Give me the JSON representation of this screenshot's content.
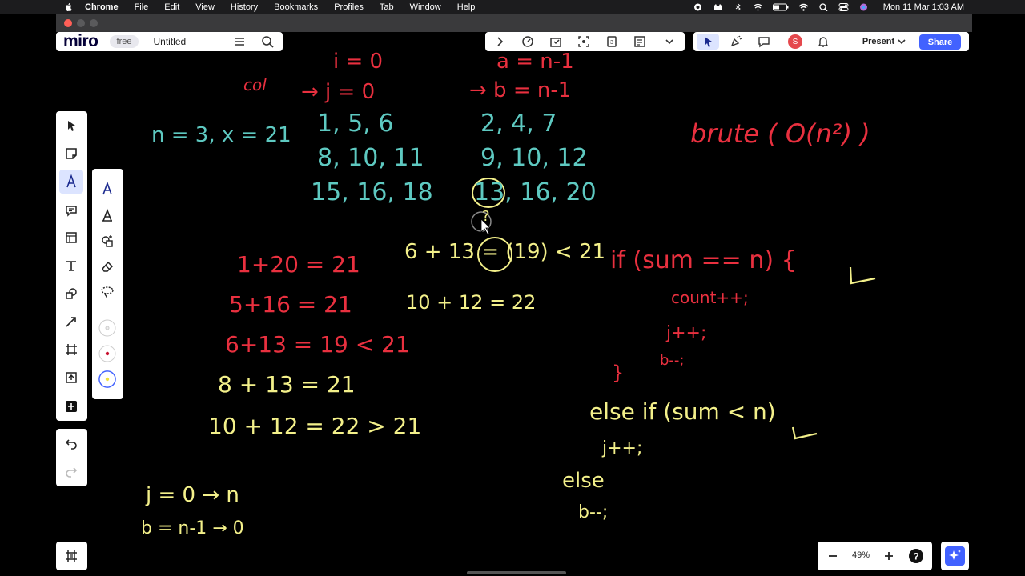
{
  "menubar": {
    "app": "Chrome",
    "menus": [
      "File",
      "Edit",
      "View",
      "History",
      "Bookmarks",
      "Profiles",
      "Tab",
      "Window",
      "Help"
    ],
    "clock": "Mon 11 Mar  1:03 AM"
  },
  "miro": {
    "logo": "miro",
    "plan_badge": "free",
    "board_name": "Untitled",
    "present_label": "Present",
    "share_label": "Share",
    "avatar_initial": "S",
    "zoom": "49%"
  },
  "colors": {
    "accent": "#4262ff",
    "handwriting_yellow": "#f3f08a",
    "handwriting_red": "#e9303f",
    "matrix_teal": "#5ec9c1"
  },
  "canvas": {
    "nx": "n = 3, x = 21",
    "matrix1": [
      "1,   5,   6",
      "8,  10, 11",
      "15, 16, 18"
    ],
    "matrix2": [
      "2,   4,   7",
      "9,  10,  12",
      "13, 16,  20"
    ],
    "i0": "i = 0",
    "j0": "→ j = 0",
    "a": "a = n-1",
    "b": "→ b = n-1",
    "col": "col",
    "brute": "brute ( O(n²) )",
    "mid_q": "?",
    "mid1": "6 + 13 = (19) < 21",
    "mid2": "10 + 12 = 22",
    "left_lines": [
      "1+20 = 21",
      "5+16 = 21",
      "6+13 = 19 < 21",
      "8 + 13 =  21",
      "10 + 12 = 22 > 21"
    ],
    "jline": "j = 0 → n",
    "bline": "b = n-1 → 0",
    "code": [
      "if (sum == n) {",
      "count++;",
      "j++;",
      "b--;",
      "}",
      "else if (sum < n)",
      "j++;",
      "else",
      "b--;"
    ],
    "checks": [
      "✓",
      "✓"
    ]
  }
}
